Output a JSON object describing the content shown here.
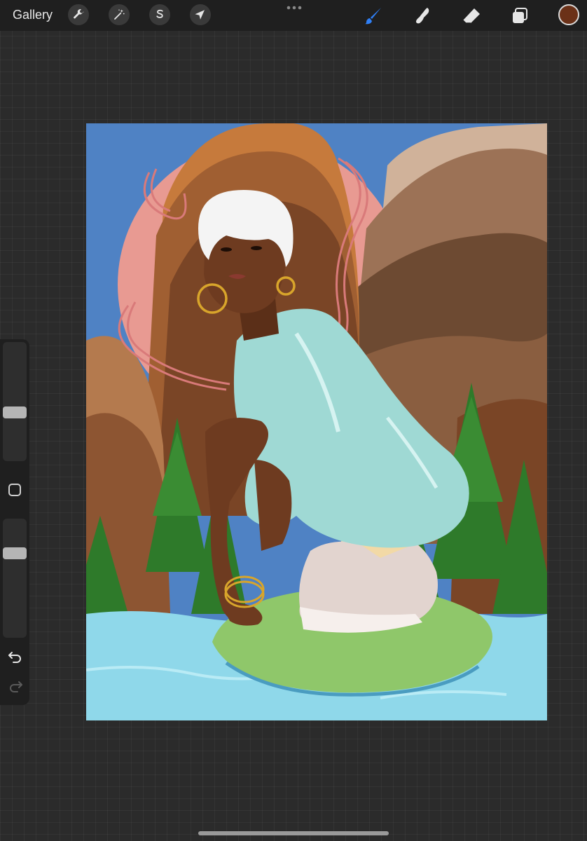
{
  "topbar": {
    "gallery_label": "Gallery",
    "left_tools": [
      "wrench-icon",
      "magic-wand-icon",
      "selection-s-icon",
      "transform-arrow-icon"
    ],
    "more_icon": "ellipsis-icon",
    "right_tools": [
      "brush-icon",
      "smudge-icon",
      "eraser-icon",
      "layers-icon"
    ],
    "active_tool": "brush-icon",
    "brush_color": "#2f7ff5",
    "current_color": "#6b3118"
  },
  "sidebar": {
    "brush_size": 0.6,
    "opacity": 0.27,
    "undo_icon": "undo-arrow-icon",
    "redo_icon": "redo-arrow-icon"
  },
  "canvas": {
    "palette": {
      "sky": "#4f82c4",
      "sun": "#e89a92",
      "water": "#8fd8ea",
      "lily_pad": "#8fc76a",
      "shirt": "#9fd9d4",
      "skin": "#6e3b20",
      "hair": "#f4f4f4",
      "trees": "#2e7a2a",
      "mountain_dark": "#7a4526",
      "mountain_light": "#b47a4e"
    }
  }
}
